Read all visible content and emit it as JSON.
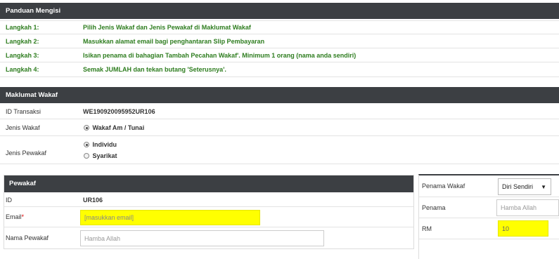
{
  "guide": {
    "title": "Panduan Mengisi",
    "steps": [
      {
        "label": "Langkah 1:",
        "text": "Pilih Jenis Wakaf dan Jenis Pewakaf di Maklumat Wakaf"
      },
      {
        "label": "Langkah 2:",
        "text": "Masukkan alamat email bagi penghantaran Slip Pembayaran"
      },
      {
        "label": "Langkah 3:",
        "text": "Isikan penama di bahagian Tambah Pecahan Wakaf'. Minimum 1 orang (nama anda sendiri)"
      },
      {
        "label": "Langkah 4:",
        "text": "Semak JUMLAH dan tekan butang 'Seterusnya'."
      }
    ]
  },
  "maklumat": {
    "title": "Maklumat Wakaf",
    "id_label": "ID Transaksi",
    "id_value": "WE190920095952UR106",
    "jenis_wakaf_label": "Jenis Wakaf",
    "jenis_wakaf_option": "Wakaf Am / Tunai",
    "jenis_pewakaf_label": "Jenis Pewakaf",
    "pewakaf_option_1": "Individu",
    "pewakaf_option_2": "Syarikat"
  },
  "pewakaf": {
    "title": "Pewakaf",
    "id_label": "ID",
    "id_value": "UR106",
    "email_label": "Email",
    "email_required": "*",
    "email_placeholder": "[masukkan email]",
    "nama_label": "Nama Pewakaf",
    "nama_placeholder": "Hamba Allah"
  },
  "penama": {
    "penama_wakaf_label": "Penama Wakaf",
    "penama_wakaf_selected": "Diri Sendiri",
    "select_arrow": "▼",
    "penama_label": "Penama",
    "penama_placeholder": "Hamba Allah",
    "rm_label": "RM",
    "rm_value": "10"
  },
  "colors": {
    "header_bg": "#3c3f43",
    "step_text": "#2e7d1f",
    "highlight_input": "#ffff00"
  }
}
